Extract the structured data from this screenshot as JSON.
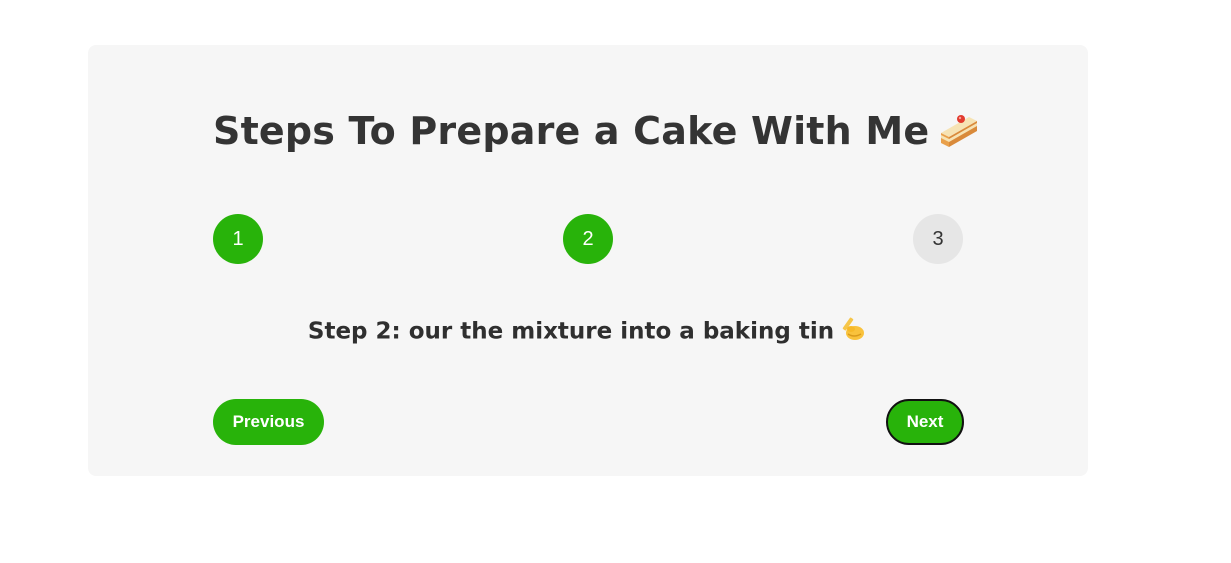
{
  "title": "Steps To Prepare a Cake With Me",
  "title_emoji": "cake-slice-icon",
  "steps": [
    {
      "number": "1",
      "active": true
    },
    {
      "number": "2",
      "active": true
    },
    {
      "number": "3",
      "active": false
    }
  ],
  "message": "Step 2: our the mixture into a baking tin",
  "message_emoji": "writing-hand-icon",
  "buttons": {
    "previous": "Previous",
    "next": "Next"
  },
  "colors": {
    "accent": "#28b30a",
    "inactive_step": "#e6e6e6",
    "card_background": "#f6f6f6"
  }
}
